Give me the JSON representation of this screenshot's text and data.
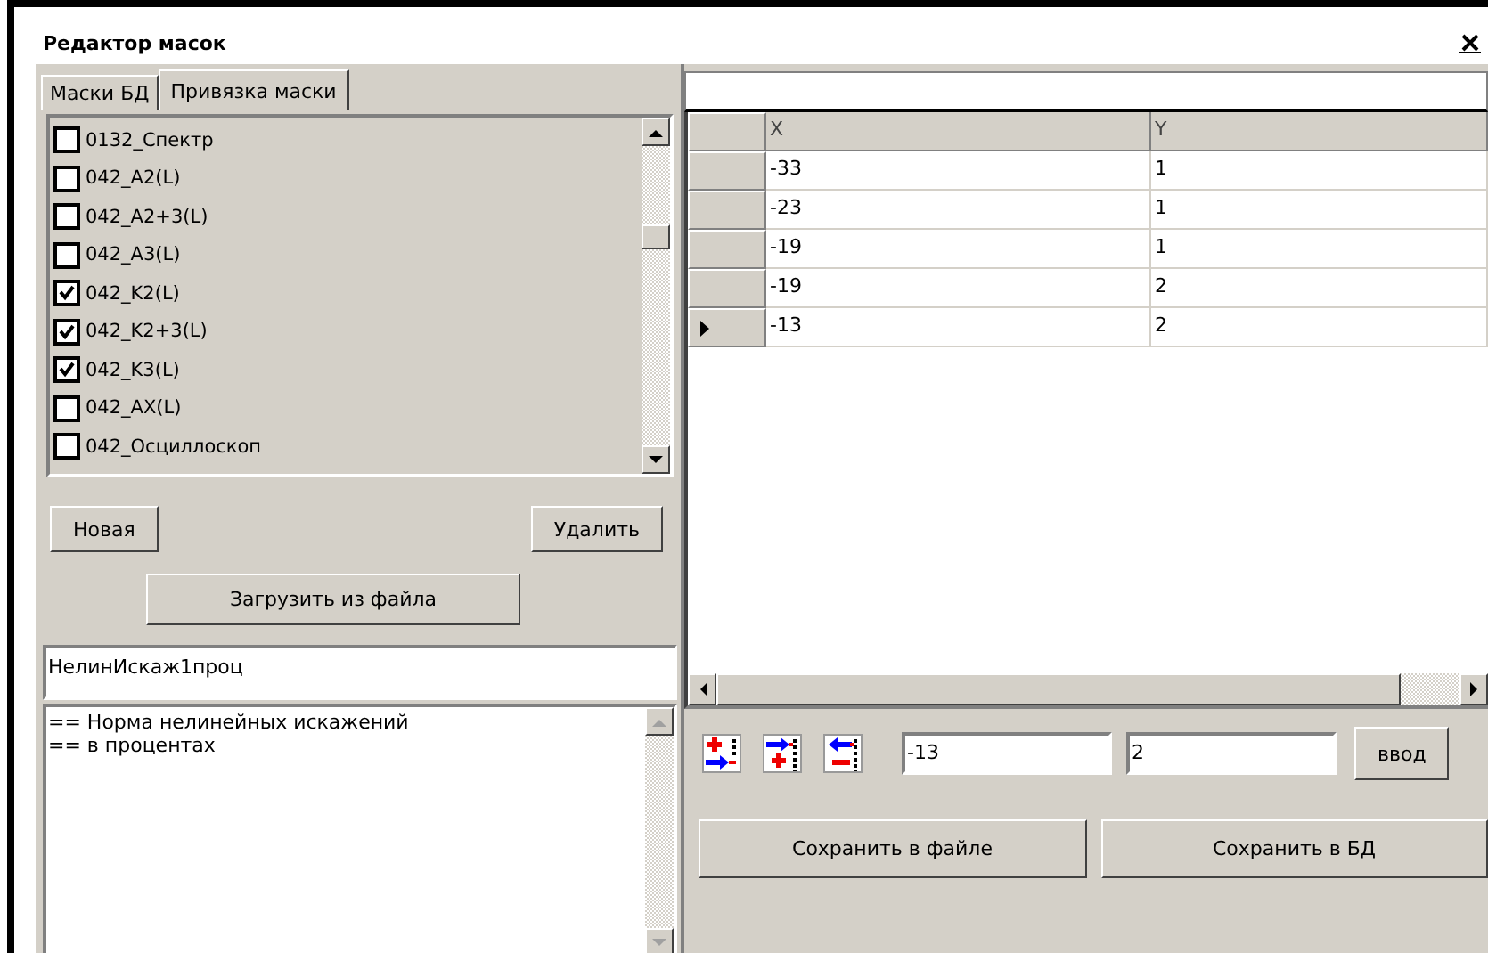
{
  "window": {
    "title": "Редактор масок"
  },
  "tabs": [
    {
      "label": "Маски БД",
      "selected": false
    },
    {
      "label": "Привязка маски",
      "selected": true
    }
  ],
  "masks": [
    {
      "label": "0132_Спектр",
      "checked": false
    },
    {
      "label": "042_A2(L)",
      "checked": false
    },
    {
      "label": "042_A2+3(L)",
      "checked": false
    },
    {
      "label": "042_A3(L)",
      "checked": false
    },
    {
      "label": "042_K2(L)",
      "checked": true
    },
    {
      "label": "042_K2+3(L)",
      "checked": true
    },
    {
      "label": "042_K3(L)",
      "checked": true
    },
    {
      "label": "042_AX(L)",
      "checked": false
    },
    {
      "label": "042_Осциллоскоп",
      "checked": false
    }
  ],
  "buttons": {
    "new": "Новая",
    "delete": "Удалить",
    "load": "Загрузить из файла"
  },
  "mask_name": {
    "value": "НелинИскаж1проц"
  },
  "description": {
    "value": "== Норма нелинейных искажений\n== в процентах"
  },
  "grid": {
    "columns": [
      "X",
      "Y"
    ],
    "rows": [
      {
        "cells": [
          "-33",
          "1"
        ],
        "selected": false
      },
      {
        "cells": [
          "-23",
          "1"
        ],
        "selected": false
      },
      {
        "cells": [
          "-19",
          "1"
        ],
        "selected": false
      },
      {
        "cells": [
          "-19",
          "2"
        ],
        "selected": false
      },
      {
        "cells": [
          "-13",
          "2"
        ],
        "selected": true
      }
    ]
  },
  "editor": {
    "x_value": "-13",
    "y_value": "2",
    "enter": "ввод"
  },
  "save_buttons": [
    "Сохранить в файле",
    "Сохранить в БД"
  ]
}
